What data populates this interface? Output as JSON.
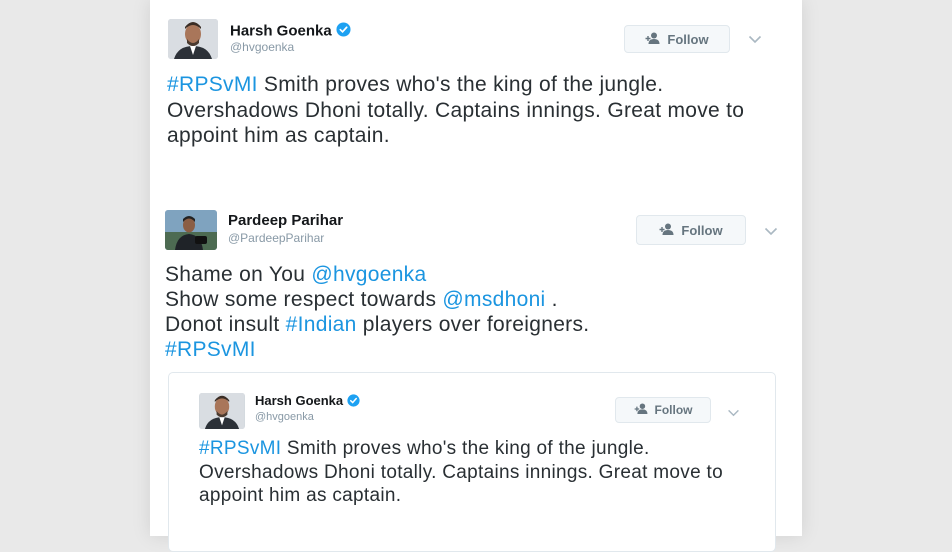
{
  "tweets": [
    {
      "name": "Harsh Goenka",
      "handle": "@hvgoenka",
      "verified": true,
      "follow_label": "Follow",
      "text": [
        {
          "t": "#RPSvMI",
          "link": true
        },
        {
          "t": " Smith proves who's the king of the jungle. Overshadows Dhoni totally. Captains innings. Great move to appoint him as captain.",
          "link": false
        }
      ]
    },
    {
      "name": "Pardeep Parihar",
      "handle": "@PardeepParihar",
      "verified": false,
      "follow_label": "Follow",
      "lines": [
        [
          {
            "t": "Shame on You ",
            "link": false
          },
          {
            "t": "@hvgoenka",
            "link": true
          }
        ],
        [
          {
            "t": "Show some respect towards ",
            "link": false
          },
          {
            "t": "@msdhoni",
            "link": true
          },
          {
            "t": " .",
            "link": false
          }
        ],
        [
          {
            "t": "Donot insult ",
            "link": false
          },
          {
            "t": "#Indian",
            "link": true
          },
          {
            "t": " players over foreigners.",
            "link": false
          }
        ],
        [
          {
            "t": "#RPSvMI",
            "link": true
          }
        ]
      ]
    }
  ],
  "quoted_tweet": {
    "name": "Harsh Goenka",
    "handle": "@hvgoenka",
    "verified": true,
    "follow_label": "Follow",
    "text": [
      {
        "t": "#RPSvMI",
        "link": true
      },
      {
        "t": " Smith proves who's the king of the jungle. Overshadows Dhoni totally. Captains innings. Great move to appoint him as captain.",
        "link": false
      }
    ]
  },
  "icons": {
    "verified": "verified-badge-icon",
    "follow": "add-person-icon",
    "caret": "chevron-down-icon"
  },
  "colors": {
    "link": "#1b95e0",
    "verified": "#1da1f2",
    "text": "#292f33",
    "muted": "#8899a6"
  }
}
